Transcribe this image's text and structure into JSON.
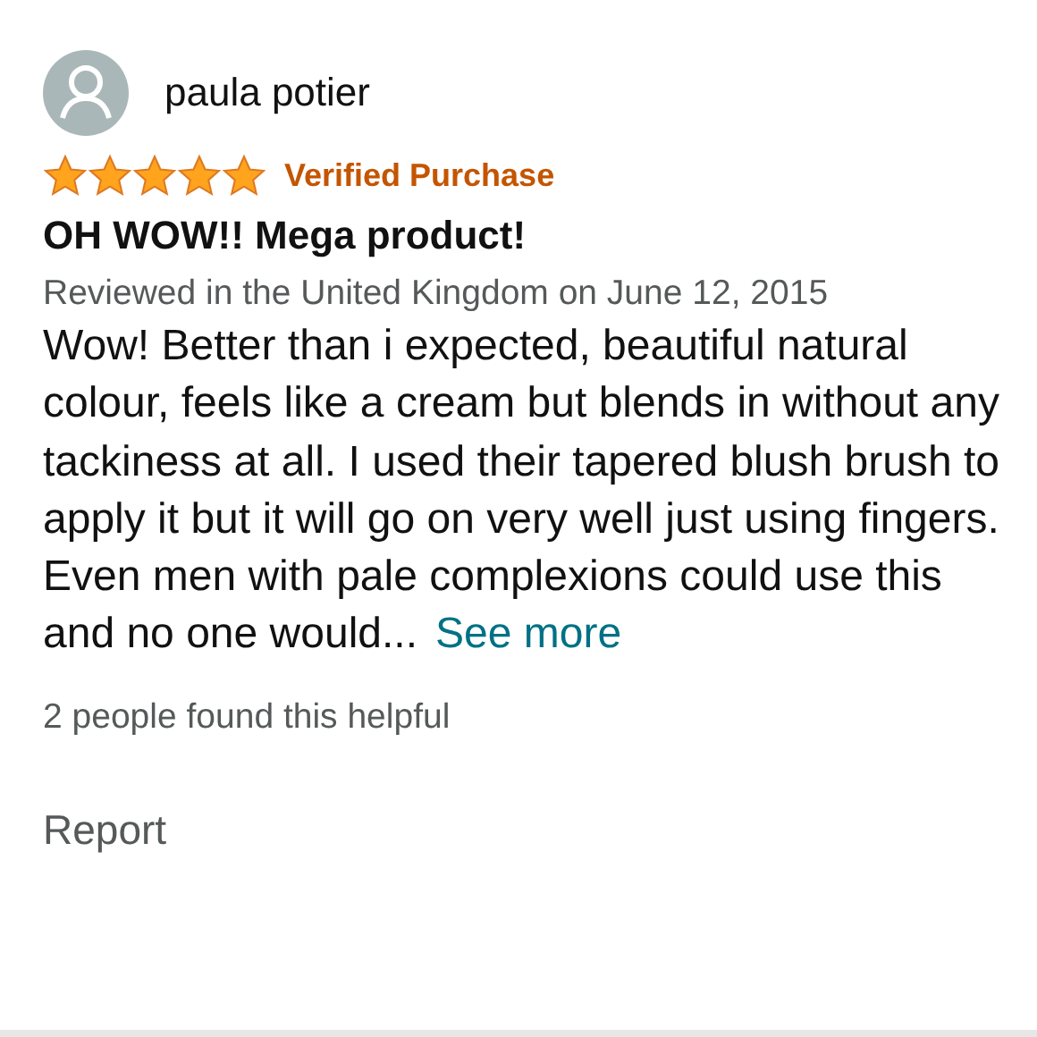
{
  "review": {
    "author": "paula potier",
    "stars": 5,
    "badge": "Verified Purchase",
    "title": "OH WOW!! Mega product!",
    "meta": "Reviewed in the United Kingdom on June 12, 2015",
    "body": "Wow! Better than i expected, beautiful natural colour, feels like a cream but blends in without any tackiness at all. I used their tapered blush brush to apply it but it will go on very well just using fingers. Even men with pale complexions could use this and no one would...",
    "more_link": "See more",
    "helpful": "2 people found this helpful",
    "report": "Report"
  }
}
